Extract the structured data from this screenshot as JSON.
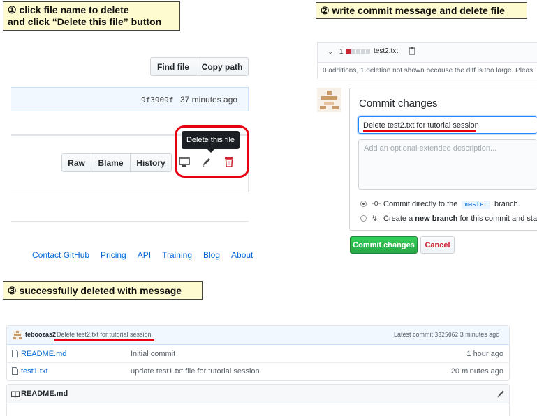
{
  "callouts": {
    "step1": "① click file name to delete\nand click “Delete this file” button",
    "step2": "② write commit message and delete file",
    "step3": "③ successfully deleted with message"
  },
  "panel1": {
    "find_file": "Find file",
    "copy_path": "Copy path",
    "commit_hash": "9f3909f",
    "commit_time": "37 minutes ago",
    "tooltip": "Delete this file",
    "raw": "Raw",
    "blame": "Blame",
    "history": "History",
    "footer_links": [
      "Contact GitHub",
      "Pricing",
      "API",
      "Training",
      "Blog",
      "About"
    ]
  },
  "panel2": {
    "diff_count": "1",
    "diff_filename": "test2.txt",
    "diff_note": "0 additions, 1 deletion not shown because the diff is too large. Pleas",
    "commit_header": "Commit changes",
    "commit_message": "Delete test2.txt for tutorial session",
    "description_placeholder": "Add an optional extended description...",
    "option1_prefix": "Commit directly to the",
    "option1_branch": "master",
    "option1_suffix": "branch.",
    "option2_prefix": "Create a",
    "option2_bold": "new branch",
    "option2_suffix": "for this commit and start a",
    "commit_button": "Commit changes",
    "cancel_button": "Cancel"
  },
  "panel3": {
    "author": "teboozas2",
    "message": "Delete test2.txt for tutorial session",
    "latest_commit_label": "Latest commit",
    "latest_commit_hash": "3825062",
    "latest_commit_time": "3 minutes ago",
    "files": [
      {
        "name": "README.md",
        "message": "Initial commit",
        "age": "1 hour ago"
      },
      {
        "name": "test1.txt",
        "message": "update test1.txt file for tutorial session",
        "age": "20 minutes ago"
      }
    ],
    "readme_header": "README.md"
  },
  "colors": {
    "callout_bg": "#fffbd0",
    "highlight_red": "#e60012",
    "link_blue": "#0366d6",
    "commit_green": "#28a745"
  }
}
